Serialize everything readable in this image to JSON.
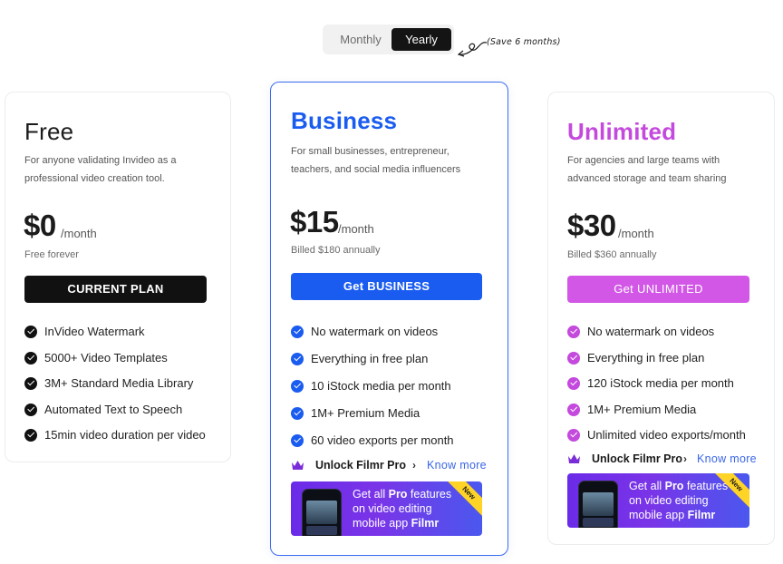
{
  "billing": {
    "monthly_label": "Monthly",
    "yearly_label": "Yearly",
    "selected": "Yearly",
    "save_note": "(Save 6 months)"
  },
  "colors": {
    "business_accent": "#1a5cf0",
    "unlimited_accent": "#c449dd",
    "free_button": "#111111"
  },
  "plans": {
    "free": {
      "name": "Free",
      "description_line1": "For anyone validating Invideo as a",
      "description_line2": "professional video creation tool.",
      "price": "$0",
      "period": "/month",
      "billed": "Free forever",
      "cta": "CURRENT PLAN",
      "features": [
        "InVideo Watermark",
        "5000+ Video Templates",
        "3M+ Standard Media Library",
        "Automated Text to Speech",
        "15min video duration per video"
      ]
    },
    "business": {
      "name": "Business",
      "description_line1": "For small businesses, entrepreneur,",
      "description_line2": "teachers, and social media influencers",
      "price": "$15",
      "period": "/month",
      "billed": "Billed $180 annually",
      "cta": "Get BUSINESS",
      "features": [
        "No watermark on videos",
        "Everything in free plan",
        "10 iStock media per month",
        "1M+ Premium Media",
        "60 video exports per month"
      ],
      "filmr": {
        "unlock": "Unlock Filmr Pro",
        "arrow": "›",
        "know_more": "Know more"
      },
      "banner": {
        "line1_prefix": "Get all ",
        "line1_bold": "Pro",
        "line1_suffix": " features",
        "line2": "on video editing",
        "line3_prefix": "mobile app ",
        "line3_bold": "Filmr",
        "badge": "New"
      }
    },
    "unlimited": {
      "name": "Unlimited",
      "description_line1": "For agencies and large teams with",
      "description_line2": "advanced storage and team sharing",
      "price": "$30",
      "period": "/month",
      "billed": "Billed $360 annually",
      "cta": "Get UNLIMITED",
      "features": [
        "No watermark on videos",
        "Everything in free plan",
        "120 iStock media per month",
        "1M+ Premium Media",
        "Unlimited video exports/month"
      ],
      "filmr": {
        "unlock": "Unlock Filmr Pro",
        "arrow": "›",
        "know_more": "Know more"
      },
      "banner": {
        "line1_prefix": "Get all ",
        "line1_bold": "Pro",
        "line1_suffix": " features",
        "line2": "on video editing",
        "line3_prefix": "mobile app ",
        "line3_bold": "Filmr",
        "badge": "New"
      }
    }
  }
}
